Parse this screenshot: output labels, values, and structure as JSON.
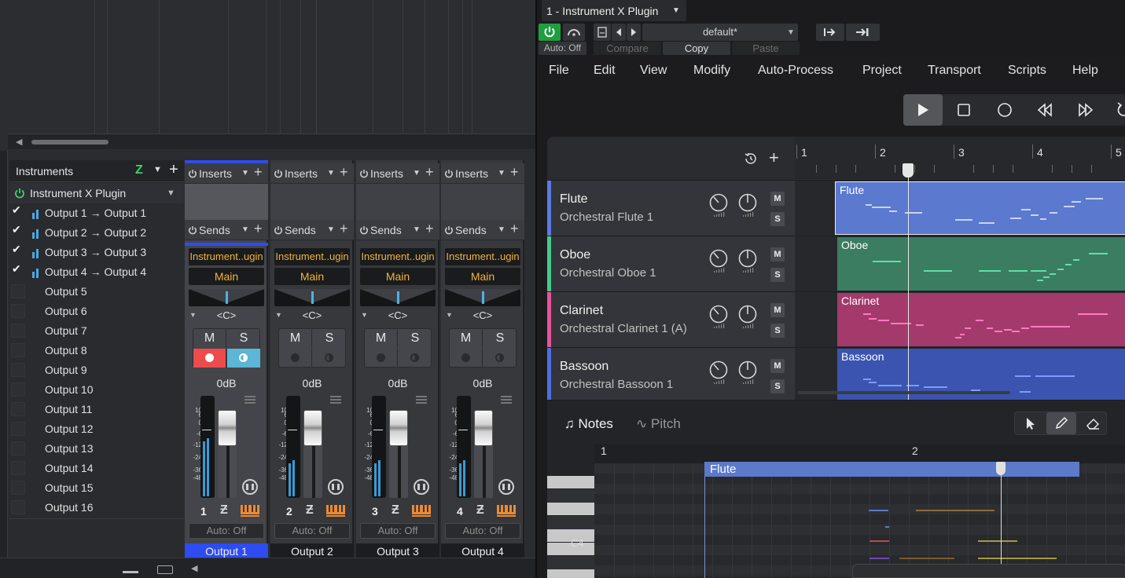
{
  "left_panel": {
    "instruments_title": "Instruments",
    "plugin_name": "Instrument X Plugin",
    "outputs": [
      {
        "label": "Output 1 → Output 1",
        "checked": true
      },
      {
        "label": "Output 2 → Output 2",
        "checked": true
      },
      {
        "label": "Output 3 → Output 3",
        "checked": true
      },
      {
        "label": "Output 4 → Output 4",
        "checked": true
      },
      {
        "label": "Output 5",
        "checked": false
      },
      {
        "label": "Output 6",
        "checked": false
      },
      {
        "label": "Output 7",
        "checked": false
      },
      {
        "label": "Output 8",
        "checked": false
      },
      {
        "label": "Output 9",
        "checked": false
      },
      {
        "label": "Output 10",
        "checked": false
      },
      {
        "label": "Output 11",
        "checked": false
      },
      {
        "label": "Output 12",
        "checked": false
      },
      {
        "label": "Output 13",
        "checked": false
      },
      {
        "label": "Output 14",
        "checked": false
      },
      {
        "label": "Output 15",
        "checked": false
      },
      {
        "label": "Output 16",
        "checked": false
      }
    ]
  },
  "mixer": {
    "inserts_label": "Inserts",
    "sends_label": "Sends",
    "pan_label": "<C>",
    "mute_label": "M",
    "solo_label": "S",
    "scale": [
      "10",
      "6",
      "0",
      "-6",
      "-12",
      "-24",
      "-36",
      "-48"
    ],
    "channels": [
      {
        "instrument": "Instrument..ugin",
        "bus": "Main",
        "volume": "0dB",
        "number": "1",
        "auto": "Auto: Off",
        "output": "Output 1",
        "selected": true
      },
      {
        "instrument": "Instrument..ugin",
        "bus": "Main",
        "volume": "0dB",
        "number": "2",
        "auto": "Auto: Off",
        "output": "Output 2",
        "selected": false
      },
      {
        "instrument": "Instrument..ugin",
        "bus": "Main",
        "volume": "0dB",
        "number": "3",
        "auto": "Auto: Off",
        "output": "Output 3",
        "selected": false
      },
      {
        "instrument": "Instrument..ugin",
        "bus": "Main",
        "volume": "0dB",
        "number": "4",
        "auto": "Auto: Off",
        "output": "Output 4",
        "selected": false
      }
    ]
  },
  "plugin_window": {
    "title": "1 - Instrument X Plugin",
    "preset": "default*",
    "auto": "Auto: Off",
    "compare": "Compare",
    "copy": "Copy",
    "paste": "Paste",
    "menu": [
      "File",
      "Edit",
      "View",
      "Modify",
      "Auto-Process",
      "Project",
      "Transport",
      "Scripts",
      "Help"
    ],
    "ruler": [
      "1",
      "2",
      "3",
      "4",
      "5"
    ],
    "tracks": [
      {
        "name": "Flute",
        "sub": "Orchestral Flute 1",
        "color": "#5b7ce0",
        "clip_color": "#5a79cf",
        "note_color": "#c9d3f2"
      },
      {
        "name": "Oboe",
        "sub": "Orchestral Oboe 1",
        "color": "#46c98a",
        "clip_color": "#3a7d60",
        "note_color": "#5fe0a8"
      },
      {
        "name": "Clarinet",
        "sub": "Orchestral Clarinet 1 (A)",
        "color": "#e6559a",
        "clip_color": "#a33a6b",
        "note_color": "#ff7ac0"
      },
      {
        "name": "Bassoon",
        "sub": "Orchestral Bassoon 1",
        "color": "#4e6fe0",
        "clip_color": "#3a54b0",
        "note_color": "#7f9bff"
      }
    ],
    "mute_label": "M",
    "solo_label": "S",
    "notes_tab": "Notes",
    "pitch_tab": "Pitch",
    "piano_roll": {
      "ruler": [
        "1",
        "2"
      ],
      "clip_name": "Flute",
      "key_label": "C4"
    }
  }
}
